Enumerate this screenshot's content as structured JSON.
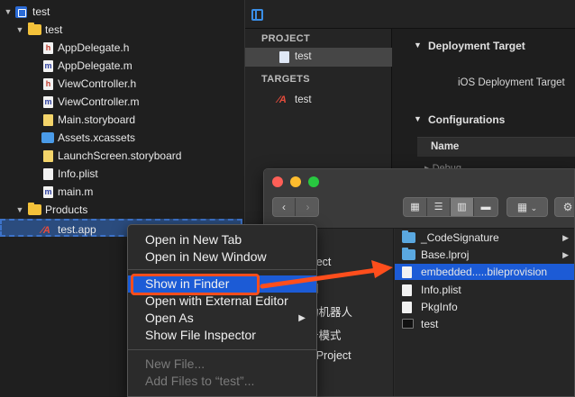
{
  "navigator": {
    "rows": [
      {
        "label": "test"
      },
      {
        "label": "test"
      },
      {
        "label": "AppDelegate.h",
        "glyph": "h"
      },
      {
        "label": "AppDelegate.m",
        "glyph": "m"
      },
      {
        "label": "ViewController.h",
        "glyph": "h"
      },
      {
        "label": "ViewController.m",
        "glyph": "m"
      },
      {
        "label": "Main.storyboard"
      },
      {
        "label": "Assets.xcassets"
      },
      {
        "label": "LaunchScreen.storyboard"
      },
      {
        "label": "Info.plist"
      },
      {
        "label": "main.m",
        "glyph": "m"
      },
      {
        "label": "Products"
      },
      {
        "label": "test.app"
      }
    ]
  },
  "project_list": {
    "project_header": "PROJECT",
    "project_item": "test",
    "targets_header": "TARGETS",
    "target_item": "test"
  },
  "settings": {
    "deployment_target": "Deployment Target",
    "ios_deployment": "iOS Deployment Target",
    "configurations": "Configurations",
    "name_col": "Name",
    "debug": "Debug"
  },
  "finder": {
    "col1_items": [
      "oject",
      "间",
      "动机器人",
      "十模式",
      "c Project"
    ],
    "col2_items": [
      {
        "label": "_CodeSignature",
        "kind": "folder",
        "arrow": true
      },
      {
        "label": "Base.lproj",
        "kind": "folder",
        "arrow": true
      },
      {
        "label": "embedded.....bileprovision",
        "kind": "doc",
        "arrow": false
      },
      {
        "label": "Info.plist",
        "kind": "doc",
        "arrow": false
      },
      {
        "label": "PkgInfo",
        "kind": "doc",
        "arrow": false
      },
      {
        "label": "test",
        "kind": "exec",
        "arrow": false
      }
    ]
  },
  "context_menu": {
    "open_new_tab": "Open in New Tab",
    "open_new_window": "Open in New Window",
    "show_in_finder": "Show in Finder",
    "open_external": "Open with External Editor",
    "open_as": "Open As",
    "show_inspector": "Show File Inspector",
    "new_file": "New File...",
    "add_files": "Add Files to “test”..."
  },
  "colors": {
    "selection_blue": "#1c5bd6",
    "annotation_red": "#ff4e1c",
    "folder_yellow": "#f4c23a",
    "folder_blue": "#5aa8e0"
  }
}
